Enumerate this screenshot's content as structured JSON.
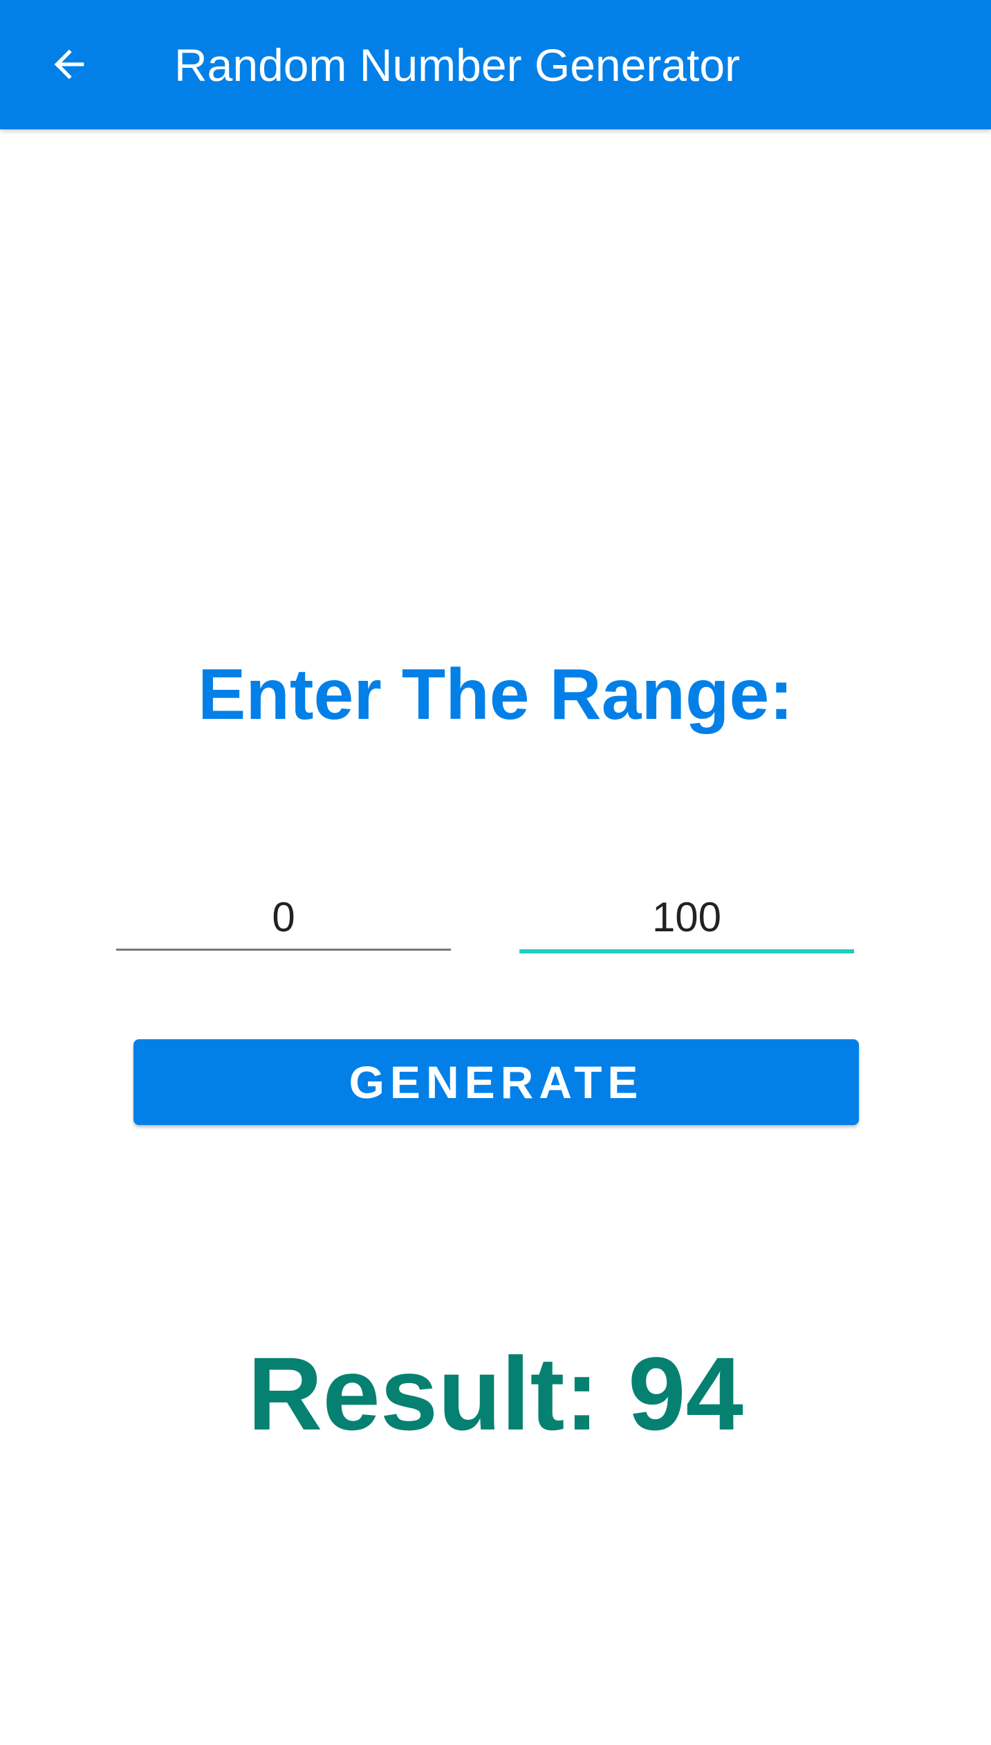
{
  "app_bar": {
    "title": "Random Number Generator",
    "back_icon": "arrow-left-icon",
    "background_color": "#0280E8"
  },
  "main": {
    "heading": "Enter The Range:",
    "min_input": {
      "value": "0"
    },
    "max_input": {
      "value": "100"
    },
    "generate_label": "GENERATE",
    "result_text": "Result: 94"
  },
  "colors": {
    "primary": "#0280E8",
    "focus_underline": "#1DCFC1",
    "result": "#068171"
  }
}
